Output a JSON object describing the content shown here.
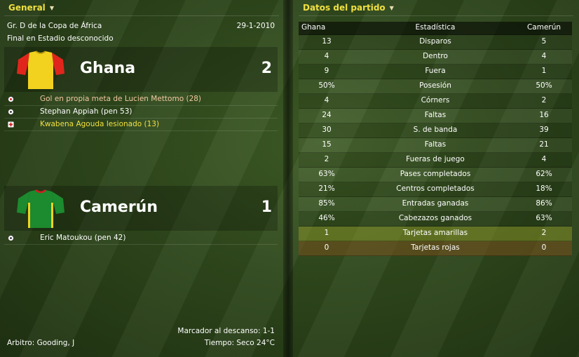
{
  "left_tab": {
    "label": "General",
    "arrow": "▼"
  },
  "right_tab": {
    "label": "Datos del partido",
    "arrow": "▼"
  },
  "match": {
    "competition": "Gr. D de la Copa de África",
    "date": "29-1-2010",
    "venue": "Final en Estadio desconocido"
  },
  "home": {
    "name": "Ghana",
    "score": "2",
    "kit_colors": {
      "body": "#f2d21e",
      "sleeves": "#e0261c"
    },
    "events": [
      {
        "icon": "own-goal-icon",
        "text": "Gol en propia meta de Lucien Mettomo (28)",
        "color": "#f2c8a0"
      },
      {
        "icon": "goal-ball-icon",
        "text": "Stephan Appiah (pen 53)",
        "color": "#ffffff"
      },
      {
        "icon": "injury-icon",
        "text": "Kwabena Agouda lesionado (13)",
        "color": "#f0e040"
      }
    ]
  },
  "away": {
    "name": "Camerún",
    "score": "1",
    "kit_colors": {
      "body": "#1c8a2e",
      "sleeves": "#1c8a2e",
      "stripe": "#f2d21e"
    },
    "events": [
      {
        "icon": "goal-ball-icon",
        "text": "Eric Matoukou (pen 42)",
        "color": "#ffffff"
      }
    ]
  },
  "footer": {
    "halftime": "Marcador al descanso: 1-1",
    "referee": "Arbitro: Gooding, J",
    "weather": "Tiempo: Seco 24°C"
  },
  "stats": {
    "header": {
      "home": "Ghana",
      "label": "Estadística",
      "away": "Camerún"
    },
    "rows": [
      {
        "home": "13",
        "label": "Disparos",
        "away": "5"
      },
      {
        "home": "4",
        "label": "Dentro",
        "away": "4"
      },
      {
        "home": "9",
        "label": "Fuera",
        "away": "1"
      },
      {
        "home": "50%",
        "label": "Posesión",
        "away": "50%"
      },
      {
        "home": "4",
        "label": "Córners",
        "away": "2"
      },
      {
        "home": "24",
        "label": "Faltas",
        "away": "16"
      },
      {
        "home": "30",
        "label": "S. de banda",
        "away": "39"
      },
      {
        "home": "15",
        "label": "Faltas",
        "away": "21"
      },
      {
        "home": "2",
        "label": "Fueras de juego",
        "away": "4"
      },
      {
        "home": "63%",
        "label": "Pases completados",
        "away": "62%"
      },
      {
        "home": "21%",
        "label": "Centros completados",
        "away": "18%"
      },
      {
        "home": "85%",
        "label": "Entradas ganadas",
        "away": "86%"
      },
      {
        "home": "46%",
        "label": "Cabezazos ganados",
        "away": "63%"
      },
      {
        "home": "1",
        "label": "Tarjetas amarillas",
        "away": "2"
      },
      {
        "home": "0",
        "label": "Tarjetas rojas",
        "away": "0"
      }
    ]
  }
}
